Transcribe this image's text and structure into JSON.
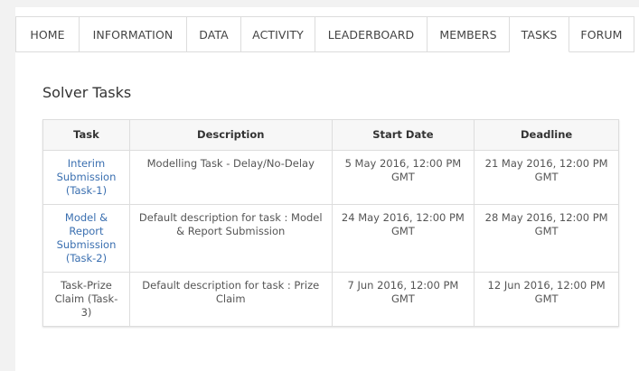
{
  "tabs": [
    {
      "label": "HOME",
      "active": false
    },
    {
      "label": "INFORMATION",
      "active": false
    },
    {
      "label": "DATA",
      "active": false
    },
    {
      "label": "ACTIVITY",
      "active": false
    },
    {
      "label": "LEADERBOARD",
      "active": false
    },
    {
      "label": "MEMBERS",
      "active": false
    },
    {
      "label": "TASKS",
      "active": true
    },
    {
      "label": "FORUM",
      "active": false
    }
  ],
  "section_title": "Solver Tasks",
  "table": {
    "headers": [
      "Task",
      "Description",
      "Start Date",
      "Deadline"
    ],
    "rows": [
      {
        "task": "Interim Submission (Task-1)",
        "task_link": true,
        "description": "Modelling Task - Delay/No-Delay",
        "start": "5 May 2016, 12:00 PM GMT",
        "deadline": "21 May 2016, 12:00 PM GMT"
      },
      {
        "task": "Model & Report Submission (Task-2)",
        "task_link": true,
        "description": "Default description for task : Model & Report Submission",
        "start": "24 May 2016, 12:00 PM GMT",
        "deadline": "28 May 2016, 12:00 PM GMT"
      },
      {
        "task": "Task-Prize Claim (Task-3)",
        "task_link": false,
        "description": "Default description for task : Prize Claim",
        "start": "7 Jun 2016, 12:00 PM GMT",
        "deadline": "12 Jun 2016, 12:00 PM GMT"
      }
    ]
  },
  "colors": {
    "link": "#3a6fb0",
    "border": "#dddddd",
    "header_bg": "#f7f7f7"
  }
}
